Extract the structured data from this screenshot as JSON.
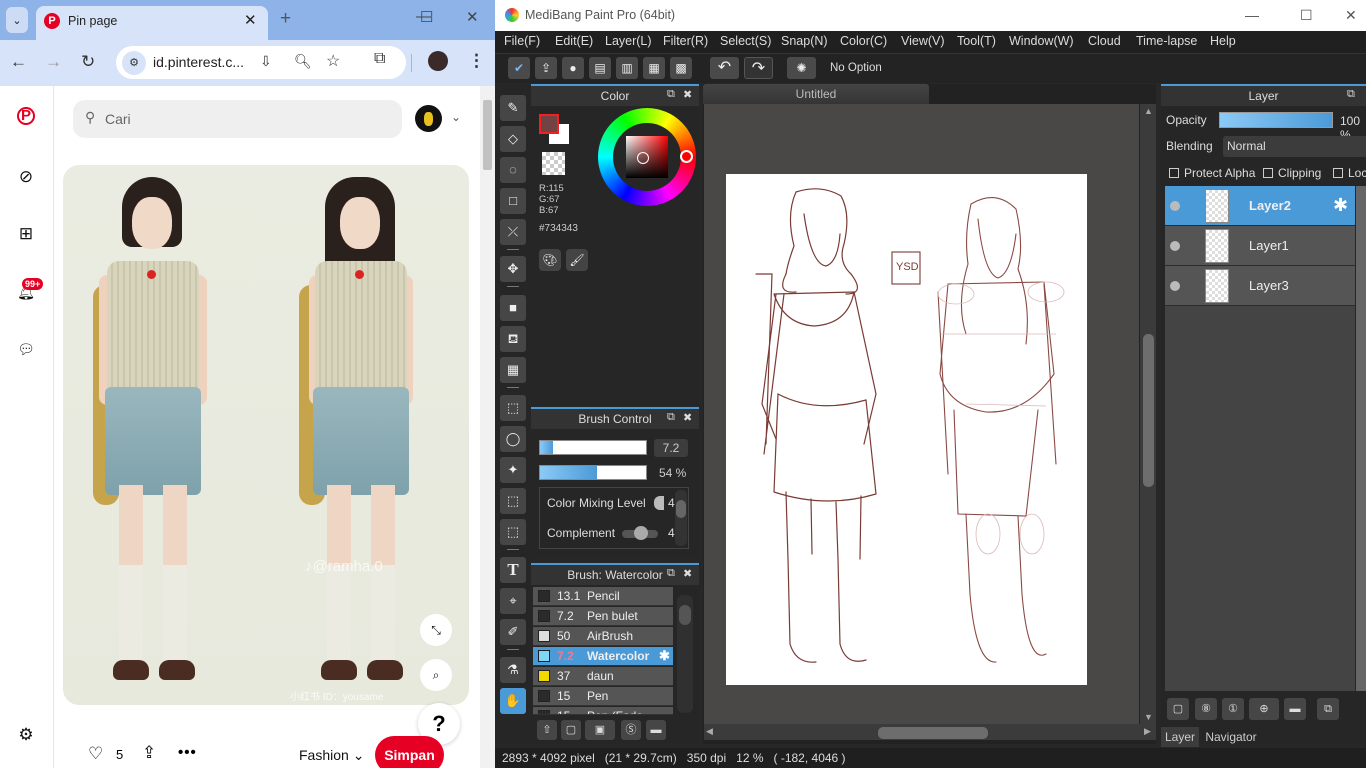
{
  "browser": {
    "tab_title": "Pin page",
    "url": "id.pinterest.c...",
    "icons": {
      "tab_list": "chevron-down-icon",
      "favicon": "pinterest-icon",
      "close": "close-icon",
      "new_tab": "plus-icon",
      "back": "back-arrow-icon",
      "forward": "forward-arrow-icon",
      "reload": "reload-icon",
      "site_info": "tune-icon",
      "install": "install-app-icon",
      "zoom": "zoom-icon",
      "bookmark": "star-icon",
      "extensions": "puzzle-icon",
      "menu": "kebab-menu-icon"
    },
    "glyphs": {
      "tab_list": "⌄",
      "close": "✕",
      "new_tab": "+",
      "minimize": "—",
      "maximize": "☐",
      "win_close": "✕",
      "back": "←",
      "forward": "→",
      "reload": "↻",
      "tune": "⚙",
      "install": "⇩",
      "zoom": "🔍︎",
      "star": "☆",
      "ext": "⧉",
      "more": "⋮"
    }
  },
  "pinterest": {
    "search_placeholder": "Cari",
    "search_glyph": "⚲",
    "notification_badge": "99+",
    "sidebar_glyphs": {
      "home": "P",
      "explore": "⊘",
      "create": "⊞",
      "notifications": "🔔︎",
      "messages": "💬︎",
      "settings": "⚙"
    },
    "watermark_1": "♪@ramha.0",
    "watermark_2": "小红书 ID：yousame",
    "expand_glyph": "⤡",
    "visual_search_glyph": "⌕",
    "help_label": "?",
    "like_glyph": "♡",
    "likes_count": "5",
    "share_glyph": "⇪",
    "more_glyph": "•••",
    "board_name": "Fashion",
    "board_chevron": "⌄",
    "save_label": "Simpan",
    "brand_color": "#e60023"
  },
  "medibang": {
    "title": "MediBang Paint Pro (64bit)",
    "window_glyphs": {
      "minimize": "—",
      "maximize": "☐",
      "close": "✕"
    },
    "menu": [
      "File(F)",
      "Edit(E)",
      "Layer(L)",
      "Filter(R)",
      "Select(S)",
      "Snap(N)",
      "Color(C)",
      "View(V)",
      "Tool(T)",
      "Window(W)",
      "Cloud",
      "Time-lapse",
      "Help"
    ],
    "toolbar_glyphs": [
      "✔",
      "⇪",
      "●",
      "▤",
      "▥",
      "▦",
      "▩"
    ],
    "undo_glyph": "↶",
    "redo_glyph": "↷",
    "spinner_glyph": "✺",
    "tool_option": "No Option",
    "tool_glyphs": [
      "✎",
      "◇",
      "◌",
      "□",
      "⤫",
      "✥",
      "■",
      "⛾",
      "▦",
      "⬚",
      "◯",
      "✦",
      "⬚",
      "⬚",
      "T",
      "⌖",
      "✐",
      "⚗",
      "✋"
    ],
    "color_panel": {
      "title": "Color",
      "r": "R:115",
      "g": "G:67",
      "b": "B:67",
      "hex": "#734343",
      "fg_color": "#734343",
      "bg_color": "#ffffff",
      "btn_glyphs": [
        "🎨︎",
        "🖌︎"
      ]
    },
    "panel_glyphs": {
      "float": "⧉",
      "close": "✖"
    },
    "brush_control": {
      "title": "Brush Control",
      "size_value": "7.2",
      "size_fraction": 0.12,
      "opacity_value": "54 %",
      "opacity_fraction": 0.54,
      "color_mixing_label": "Color Mixing Level",
      "color_mixing_value": "4",
      "complement_label": "Complement",
      "complement_value": "4"
    },
    "brush_list": {
      "title": "Brush: Watercolor",
      "items": [
        {
          "size": "13.1",
          "name": "Pencil",
          "swatch": "#2a2a2a",
          "selected": false
        },
        {
          "size": "7.2",
          "name": "Pen bulet",
          "swatch": "#2a2a2a",
          "selected": false
        },
        {
          "size": "50",
          "name": "AirBrush",
          "swatch": "#dcdcdc",
          "selected": false
        },
        {
          "size": "7.2",
          "name": "Watercolor",
          "swatch": "#7fd6f5",
          "selected": true
        },
        {
          "size": "37",
          "name": "daun",
          "swatch": "#f0d800",
          "selected": false
        },
        {
          "size": "15",
          "name": "Pen",
          "swatch": "#2a2a2a",
          "selected": false
        },
        {
          "size": "15",
          "name": "Pen (Fade In/Out)",
          "swatch": "#2a2a2a",
          "selected": false
        }
      ],
      "gear_glyph": "✱",
      "footer_glyphs": [
        "⇧",
        "▢",
        "▣",
        "Ⓢ",
        "▬"
      ]
    },
    "canvas": {
      "doc_tab": "Untitled",
      "signature": "YSD"
    },
    "layer_panel": {
      "title": "Layer",
      "opacity_label": "Opacity",
      "opacity_value": "100 %",
      "opacity_fraction": 1.0,
      "blending_label": "Blending",
      "blending_value": "Normal",
      "protect_alpha": "Protect Alpha",
      "clipping": "Clipping",
      "lock": "Lock",
      "layers": [
        {
          "name": "Layer2",
          "selected": true
        },
        {
          "name": "Layer1",
          "selected": false
        },
        {
          "name": "Layer3",
          "selected": false
        }
      ],
      "gear_glyph": "✱",
      "footer_glyphs": [
        "▢",
        "⑧",
        "①",
        "⊕",
        "▬",
        "⧉"
      ],
      "tabs": [
        "Layer",
        "Navigator"
      ]
    },
    "status_bar": "2893 * 4092 pixel   (21 * 29.7cm)   350 dpi   12 %   ( -182, 4046 )",
    "accent": "#4b9ad8"
  }
}
